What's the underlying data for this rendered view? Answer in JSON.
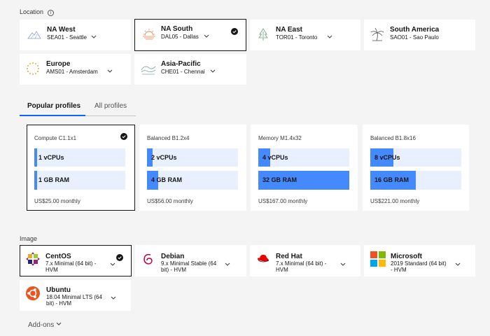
{
  "location": {
    "label": "Location",
    "regions": [
      {
        "name": "NA West",
        "sub": "SEA01 - Seattle"
      },
      {
        "name": "NA South",
        "sub": "DAL05 - Dallas"
      },
      {
        "name": "NA East",
        "sub": "TOR01 - Toronto"
      },
      {
        "name": "South America",
        "sub": "SAO01 - Sao Paulo"
      },
      {
        "name": "Europe",
        "sub": "AMS01 - Amsterdam"
      },
      {
        "name": "Asia-Pacific",
        "sub": "CHE01 - Chennai"
      }
    ]
  },
  "profiles": {
    "tabs": [
      "Popular profiles",
      "All profiles"
    ],
    "items": [
      {
        "name": "Compute C1.1x1",
        "cpu": "1 vCPUs",
        "cpu_level": 0.03,
        "ram": "1 GB RAM",
        "ram_level": 0.03,
        "price": "US$25.00 monthly"
      },
      {
        "name": "Balanced B1.2x4",
        "cpu": "2 vCPUs",
        "cpu_level": 0.06,
        "ram": "4 GB RAM",
        "ram_level": 0.12,
        "price": "US$56.00 monthly"
      },
      {
        "name": "Memory M1.4x32",
        "cpu": "4 vCPUs",
        "cpu_level": 0.13,
        "ram": "32 GB RAM",
        "ram_level": 1.0,
        "price": "US$167.00 monthly"
      },
      {
        "name": "Balanced B1.8x16",
        "cpu": "8 vCPUs",
        "cpu_level": 0.25,
        "ram": "16 GB RAM",
        "ram_level": 0.5,
        "price": "US$221.00 monthly"
      }
    ]
  },
  "image": {
    "label": "Image",
    "items": [
      {
        "name": "CentOS",
        "sub1": "7.x Minimal (64 bit) -",
        "sub2": "HVM"
      },
      {
        "name": "Debian",
        "sub1": "9.x Minimal Stable (64",
        "sub2": "bit) - HVM"
      },
      {
        "name": "Red Hat",
        "sub1": "7.x Minimal (64 bit) -",
        "sub2": "HVM"
      },
      {
        "name": "Microsoft",
        "sub1": "2019 Standard (64 bit)",
        "sub2": "- HVM"
      },
      {
        "name": "Ubuntu",
        "sub1": "18.04 Minimal LTS (64",
        "sub2": "bit) - HVM"
      }
    ]
  },
  "addons": {
    "label": "Add-ons"
  },
  "colors": {
    "accent": "#0f62fe",
    "bar_fill": "#4589ff",
    "bar_bg": "#e8f0ff"
  }
}
